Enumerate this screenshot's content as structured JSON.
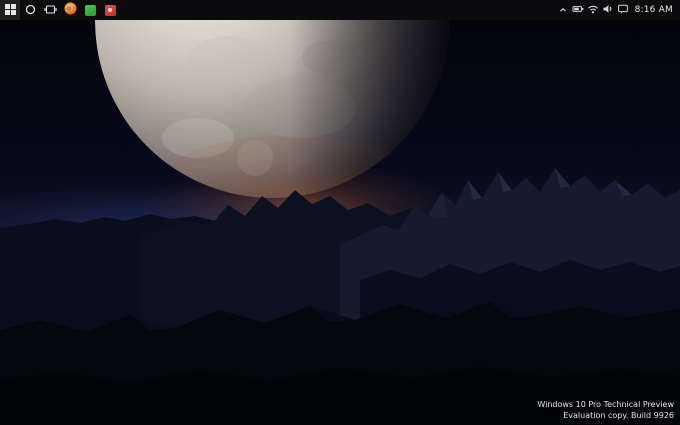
{
  "taskbar": {
    "clock": "8:16 AM",
    "apps": [
      {
        "name": "start",
        "icon": "windows-logo"
      },
      {
        "name": "search",
        "icon": "search-circle"
      },
      {
        "name": "task-view",
        "icon": "task-view"
      },
      {
        "name": "firefox",
        "icon": "firefox-orange-globe",
        "color": "#f3652a"
      },
      {
        "name": "app-green",
        "icon": "green-app-tile",
        "color": "#3cb043"
      },
      {
        "name": "app-red",
        "icon": "red-app-tile",
        "color": "#d0342c"
      }
    ],
    "tray": [
      {
        "name": "hidden-icons",
        "icon": "chevron-up"
      },
      {
        "name": "battery",
        "icon": "battery"
      },
      {
        "name": "network",
        "icon": "wifi-network"
      },
      {
        "name": "volume",
        "icon": "speaker"
      },
      {
        "name": "action-center",
        "icon": "message-square"
      }
    ]
  },
  "watermark": {
    "line1": "Windows 10 Pro Technical Preview",
    "line2": "Evaluation copy. Build 9926"
  },
  "colors": {
    "taskbar_bg": "#0b0b0d",
    "sky_deep": "#0e1126",
    "planet_light": "#f4f1ec",
    "horizon_glow": "#9a5a35",
    "mountain_dark": "#0c101f"
  }
}
